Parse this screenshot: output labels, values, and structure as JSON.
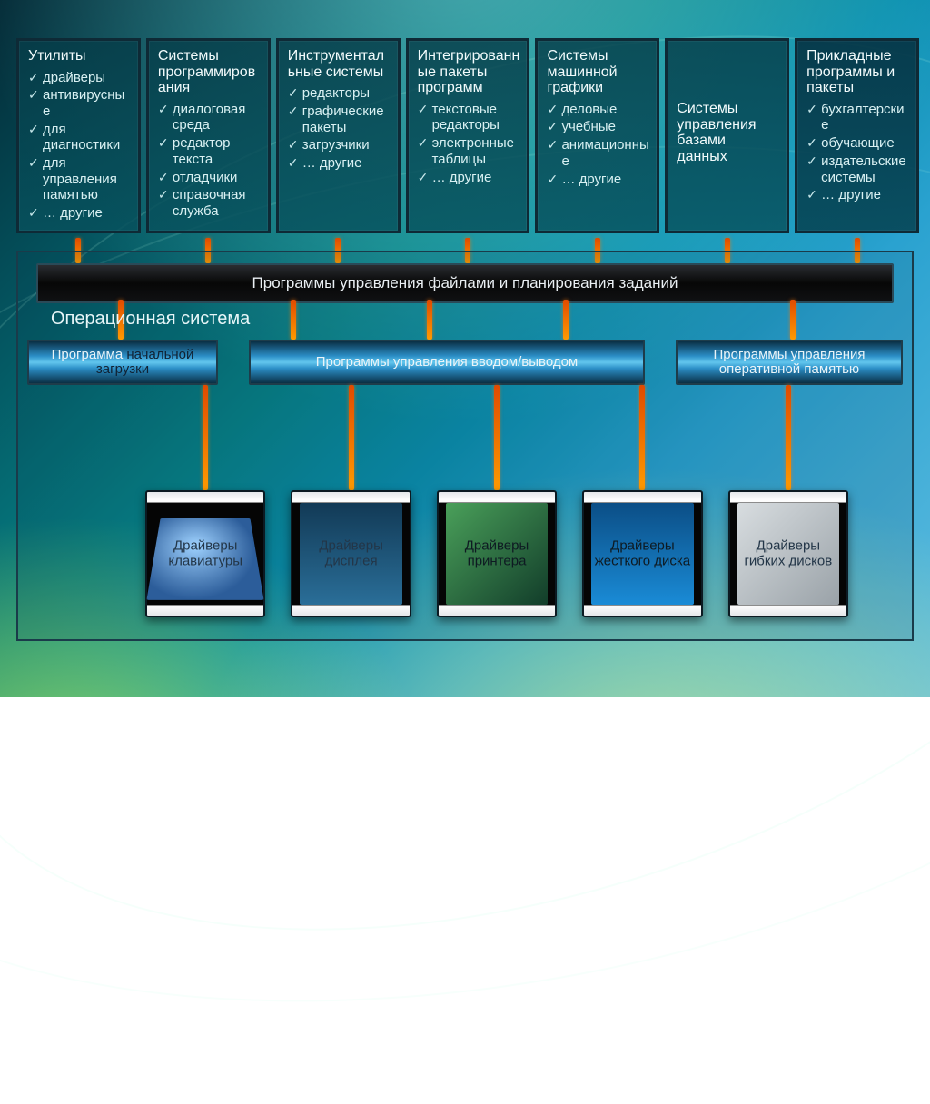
{
  "top_cards": [
    {
      "title": "Утилиты",
      "items": [
        "драйверы",
        "антивирусные",
        "для диагностики",
        "для управления памятью",
        "… другие"
      ]
    },
    {
      "title": "Системы программирования",
      "items": [
        "диалоговая среда",
        "редактор текста",
        "отладчики",
        "справочная служба"
      ]
    },
    {
      "title": "Инструментальные системы",
      "items": [
        "редакторы",
        "графические пакеты",
        "загрузчики",
        "… другие"
      ]
    },
    {
      "title": "Интегрированные пакеты программ",
      "items": [
        "текстовые редакторы",
        "электронные таблицы",
        "… другие"
      ]
    },
    {
      "title": "Системы машинной графики",
      "items": [
        "деловые",
        "учебные",
        "анимационные",
        "… другие"
      ]
    },
    {
      "title": "Системы управления базами данных",
      "items": []
    },
    {
      "title": "Прикладные программы и пакеты",
      "items": [
        "бухгалтерские",
        "обучающие",
        "издательские системы",
        "… другие"
      ]
    }
  ],
  "file_bar": "Программы управления файлами и планирования заданий",
  "os_label": "Операционная система",
  "os_boxes": {
    "left_a": "Программа ",
    "left_b": "начальной загрузки",
    "mid": "Программы управления вводом/выводом",
    "right": "Программы управления оперативной памятью"
  },
  "drivers": [
    "Драйверы клавиатуры",
    "Драйверы дисплея",
    "Драйверы принтера",
    "Драйверы жесткого диска",
    "Драйверы гибких дисков"
  ]
}
